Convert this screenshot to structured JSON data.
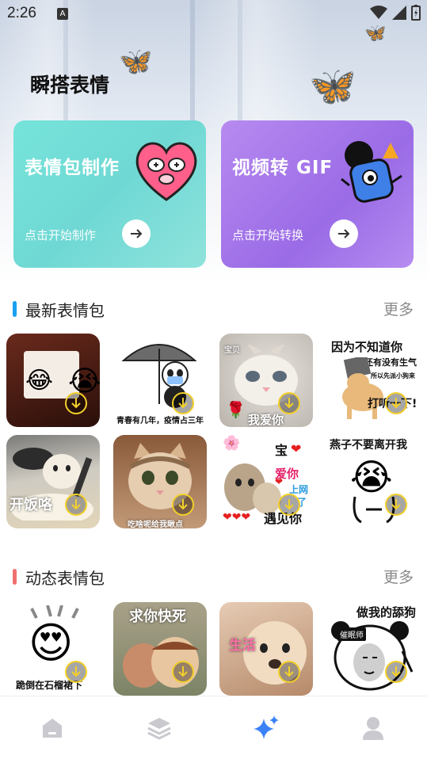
{
  "status_bar": {
    "time": "2:26",
    "indicator": "A"
  },
  "app": {
    "title": "瞬搭表情"
  },
  "cards": [
    {
      "title": "表情包制作",
      "subtitle": "点击开始制作",
      "icon": "heart-face-icon",
      "colors": [
        "#76e4da",
        "#8fe3dc"
      ]
    },
    {
      "title": "视频转 GIF",
      "subtitle": "点击开始转换",
      "icon": "blob-mascot-icon",
      "colors": [
        "#b78af0",
        "#9a6be6"
      ]
    }
  ],
  "latest": {
    "title": "最新表情包",
    "more": "更多",
    "accent": "#1aa0f0",
    "items": [
      {
        "caption": ""
      },
      {
        "caption": "青春有几年，疫情占三年"
      },
      {
        "caption": "我爱你"
      },
      {
        "caption": "因为不知道你"
      },
      {
        "caption": "开饭咯"
      },
      {
        "caption": "吃啥呢给我瞅点"
      },
      {
        "caption": "遇见你"
      },
      {
        "caption": "燕子不要离开我"
      }
    ],
    "extra_texts": {
      "t3_line2": "还有没有生气",
      "t3_line3": "所以先派小狗来",
      "t3_line4": "打听一下!",
      "t3_tag": "宝贝",
      "t6_bao": "宝",
      "t6_aini": "爱你",
      "t6_shangwang": "上网",
      "t6_le": "了"
    }
  },
  "animated": {
    "title": "动态表情包",
    "more": "更多",
    "accent": "#f07070",
    "items": [
      {
        "caption": "跪倒在石榴裙下"
      },
      {
        "caption": "求你快死"
      },
      {
        "caption": "生活"
      },
      {
        "caption": "做我的舔狗"
      }
    ],
    "extra_texts": {
      "t3_badge": "催眠师"
    }
  },
  "bottom_nav": [
    {
      "icon": "home-icon",
      "active": false
    },
    {
      "icon": "layers-icon",
      "active": false
    },
    {
      "icon": "sparkle-icon",
      "active": true
    },
    {
      "icon": "profile-icon",
      "active": false
    }
  ],
  "colors": {
    "nav_active": "#3b82f6",
    "nav_inactive": "#c9c9cf",
    "download_ring": "#f2cf2a"
  }
}
